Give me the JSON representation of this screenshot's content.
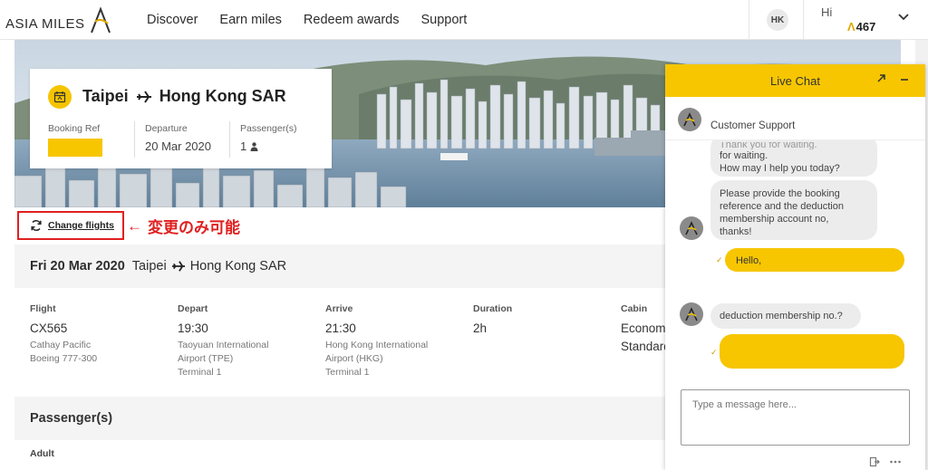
{
  "header": {
    "logo_text": "ASIA MILES",
    "nav": [
      "Discover",
      "Earn miles",
      "Redeem awards",
      "Support"
    ],
    "lang": "HK",
    "greeting": "Hi",
    "miles_prefix": "Λ",
    "miles": "467"
  },
  "booking": {
    "origin": "Taipei",
    "destination": "Hong Kong SAR",
    "booking_ref_label": "Booking Ref",
    "departure_label": "Departure",
    "departure_value": "20 Mar 2020",
    "passengers_label": "Passenger(s)",
    "passengers_value": "1"
  },
  "change_flights": "Change flights",
  "annotation": {
    "arrow": "←",
    "text": "変更のみ可能"
  },
  "flight_header": {
    "date": "Fri 20 Mar 2020",
    "origin": "Taipei",
    "destination": "Hong Kong SAR"
  },
  "flight": {
    "flight_label": "Flight",
    "flight_no": "CX565",
    "airline": "Cathay Pacific",
    "aircraft": "Boeing 777-300",
    "depart_label": "Depart",
    "depart_time": "19:30",
    "depart_airport_1": "Taoyuan International",
    "depart_airport_2": "Airport (TPE)",
    "depart_terminal": "Terminal 1",
    "arrive_label": "Arrive",
    "arrive_time": "21:30",
    "arrive_airport_1": "Hong Kong International",
    "arrive_airport_2": "Airport (HKG)",
    "arrive_terminal": "Terminal 1",
    "duration_label": "Duration",
    "duration": "2h",
    "cabin_label": "Cabin",
    "cabin_1": "Econom",
    "cabin_2": "Standard"
  },
  "passengers_section": {
    "title": "Passenger(s)",
    "adult": "Adult"
  },
  "chat": {
    "title": "Live Chat",
    "agent_name": "Customer Support",
    "msg1_partial": "Thank you for waiting.",
    "msg1_line2": "for waiting.",
    "msg1_line3": "How may I help you today?",
    "msg2_l1": "Please provide the booking",
    "msg2_l2": "reference and the deduction",
    "msg2_l3": "membership account no,",
    "msg2_l4": "thanks!",
    "reply1": "Hello,",
    "msg3": "deduction membership no.?",
    "input_placeholder": "Type a message here...",
    "tick": "✓"
  },
  "colors": {
    "brand_yellow": "#f7c600",
    "annotation_red": "#e02020"
  }
}
